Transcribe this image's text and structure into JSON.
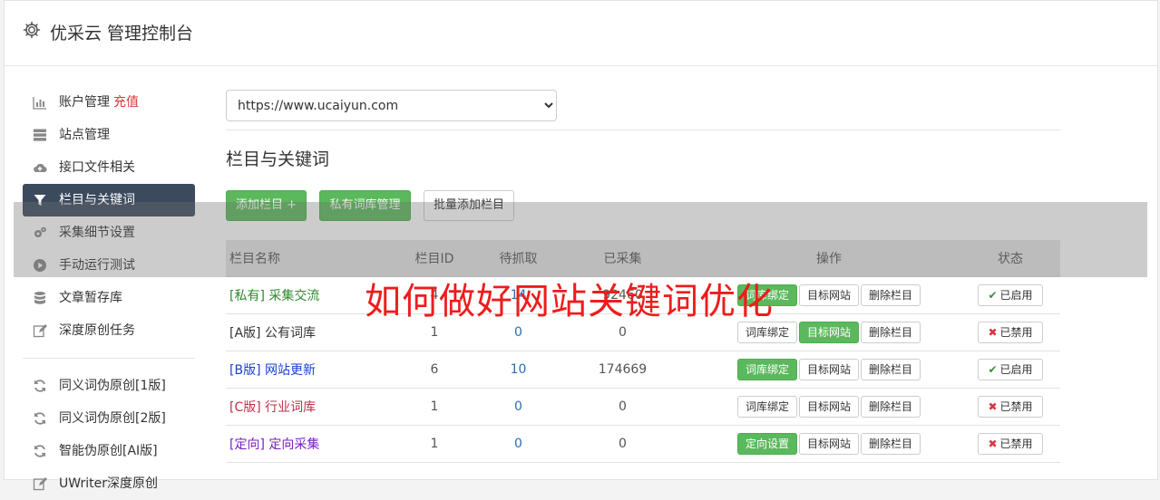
{
  "header": {
    "title": "优采云 管理控制台"
  },
  "sidebar": {
    "items": [
      {
        "label": "账户管理",
        "badge": "充值",
        "icon": "bar-chart-icon"
      },
      {
        "label": "站点管理",
        "icon": "server-icon"
      },
      {
        "label": "接口文件相关",
        "icon": "cloud-upload-icon"
      },
      {
        "label": "栏目与关键词",
        "icon": "filter-icon",
        "active": true
      },
      {
        "label": "采集细节设置",
        "icon": "cogs-icon"
      },
      {
        "label": "手动运行测试",
        "icon": "play-icon"
      },
      {
        "label": "文章暂存库",
        "icon": "database-icon"
      },
      {
        "label": "深度原创任务",
        "icon": "edit-icon"
      }
    ],
    "items2": [
      {
        "label": "同义词伪原创[1版]",
        "icon": "refresh-icon"
      },
      {
        "label": "同义词伪原创[2版]",
        "icon": "refresh-icon"
      },
      {
        "label": "智能伪原创[AI版]",
        "icon": "refresh-icon"
      },
      {
        "label": "UWriter深度原创",
        "icon": "edit-icon"
      }
    ]
  },
  "main": {
    "site_select": "https://www.ucaiyun.com",
    "section_title": "栏目与关键词",
    "toolbar": {
      "add_column": "添加栏目 +",
      "private_lib": "私有词库管理",
      "batch_add": "批量添加栏目"
    },
    "table": {
      "headers": [
        "栏目名称",
        "栏目ID",
        "待抓取",
        "已采集",
        "操作",
        "状态"
      ],
      "rows": [
        {
          "tag": "[私有]",
          "name": "采集交流",
          "color": "#2e8b2e",
          "id": "4",
          "pending": "14",
          "collected": "92460",
          "op1": "词库绑定",
          "op1_green": true,
          "op2": "目标网站",
          "op2_green": false,
          "op3": "删除栏目",
          "status": "已启用",
          "enabled": true
        },
        {
          "tag": "[A版]",
          "name": "公有词库",
          "color": "#333333",
          "id": "1",
          "pending": "0",
          "collected": "0",
          "op1": "词库绑定",
          "op1_green": false,
          "op2": "目标网站",
          "op2_green": true,
          "op3": "删除栏目",
          "status": "已禁用",
          "enabled": false
        },
        {
          "tag": "[B版]",
          "name": "网站更新",
          "color": "#1a3fd4",
          "id": "6",
          "pending": "10",
          "collected": "174669",
          "op1": "词库绑定",
          "op1_green": true,
          "op2": "目标网站",
          "op2_green": false,
          "op3": "删除栏目",
          "status": "已启用",
          "enabled": true
        },
        {
          "tag": "[C版]",
          "name": "行业词库",
          "color": "#c0304a",
          "id": "1",
          "pending": "0",
          "collected": "0",
          "op1": "词库绑定",
          "op1_green": false,
          "op2": "目标网站",
          "op2_green": false,
          "op3": "删除栏目",
          "status": "已禁用",
          "enabled": false
        },
        {
          "tag": "[定向]",
          "name": "定向采集",
          "color": "#7a1fc4",
          "id": "1",
          "pending": "0",
          "collected": "0",
          "op1": "定向设置",
          "op1_green": true,
          "op2": "目标网站",
          "op2_green": false,
          "op3": "删除栏目",
          "status": "已禁用",
          "enabled": false
        }
      ]
    }
  },
  "watermark": "如何做好网站关键词优化",
  "colors": {
    "accent": "#5cb85c",
    "active_nav": "#3c4a5e",
    "danger": "#d9363e",
    "enabled_mark": "#3c8f3c"
  }
}
